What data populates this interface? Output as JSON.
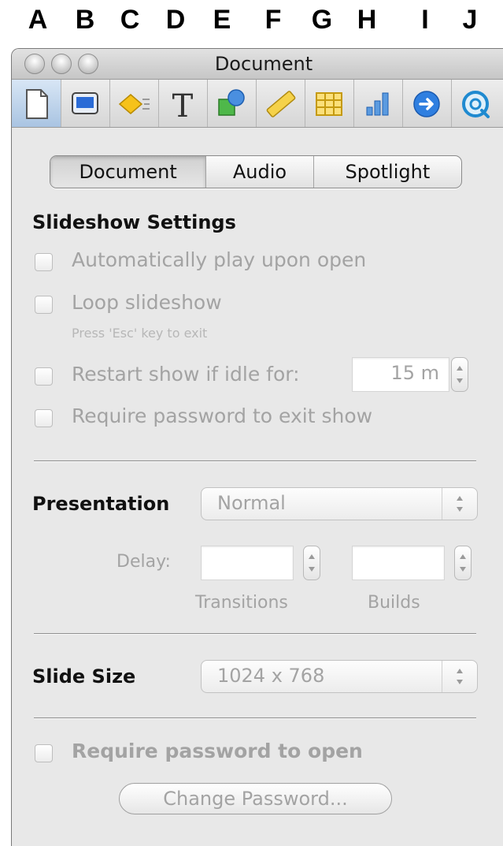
{
  "letters": [
    "A",
    "B",
    "C",
    "D",
    "E",
    "F",
    "G",
    "H",
    "I",
    "J"
  ],
  "window": {
    "title": "Document"
  },
  "toolbar": {
    "icons": [
      "document-inspector-icon",
      "slide-inspector-icon",
      "build-inspector-icon",
      "text-inspector-icon",
      "graphic-inspector-icon",
      "metrics-inspector-icon",
      "table-inspector-icon",
      "chart-inspector-icon",
      "hyperlink-inspector-icon",
      "quicktime-inspector-icon"
    ],
    "selected_index": 0
  },
  "tabs": [
    "Document",
    "Audio",
    "Spotlight"
  ],
  "active_tab": "Document",
  "slideshow": {
    "header": "Slideshow Settings",
    "autoplay": "Automatically play upon open",
    "loop": "Loop slideshow",
    "loop_hint": "Press 'Esc' key to exit",
    "restart": "Restart show if idle for:",
    "restart_value": "15 m",
    "require_exit_pw": "Require password to exit show"
  },
  "presentation": {
    "label": "Presentation",
    "value": "Normal",
    "delay_label": "Delay:",
    "transitions_label": "Transitions",
    "builds_label": "Builds"
  },
  "slide_size": {
    "label": "Slide Size",
    "value": "1024 x 768"
  },
  "security": {
    "require_open_pw": "Require password to open",
    "change_pw_button": "Change Password..."
  },
  "colors": {
    "selected_tab_bg": "#a9c4e2",
    "disabled_text": "#a3a3a3"
  }
}
